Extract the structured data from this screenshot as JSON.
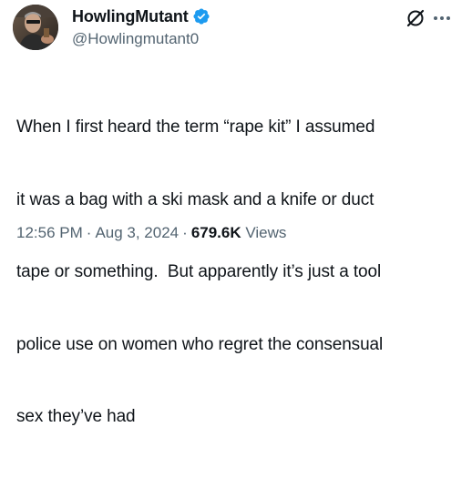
{
  "author": {
    "display_name": "HowlingMutant",
    "handle": "@Howlingmutant0",
    "verified": true,
    "verified_color": "#1d9bf0"
  },
  "actions": {
    "grok_icon": "grok-icon",
    "more_icon": "more-horizontal-icon"
  },
  "tweet": {
    "lines": [
      "When I first heard the term “rape kit” I assumed",
      "it was a bag with a ski mask and a knife or duct",
      "tape or something.  But apparently it’s just a tool",
      "police use on women who regret the consensual",
      "sex they’ve had"
    ]
  },
  "meta": {
    "time": "12:56 PM",
    "dot1": "·",
    "date": "Aug 3, 2024",
    "dot2": "·",
    "views_count": "679.6K",
    "views_label": "Views"
  },
  "colors": {
    "text_primary": "#0f1419",
    "text_secondary": "#536471"
  }
}
